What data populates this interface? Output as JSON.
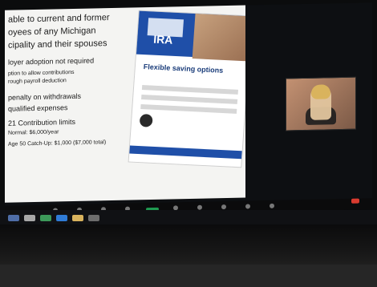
{
  "slide": {
    "lines": [
      "able to current and former",
      "oyees of any Michigan",
      "cipality and their spouses",
      "loyer adoption not required",
      "ption to allow contributions",
      "rough payroll deduction",
      "penalty on withdrawals",
      "qualified expenses",
      "21 Contribution limits",
      "Normal: $6,000/year",
      "Age 50 Catch-Up: $1,000 ($7,000 total)"
    ]
  },
  "brochure": {
    "product": "IRA",
    "heading": "Flexible saving options"
  }
}
